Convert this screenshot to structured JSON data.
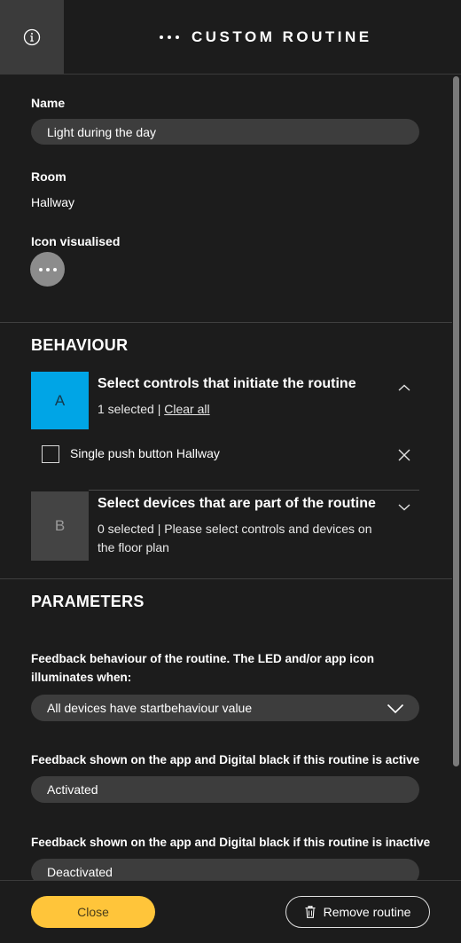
{
  "header": {
    "title": "CUSTOM ROUTINE",
    "info_icon": "info-icon",
    "more_icon": "more-dots-icon"
  },
  "general": {
    "name_label": "Name",
    "name_value": "Light during the day",
    "room_label": "Room",
    "room_value": "Hallway",
    "icon_label": "Icon visualised",
    "icon_name": "more-dots-icon"
  },
  "behaviour": {
    "title": "BEHAVIOUR",
    "controls": {
      "badge": "A",
      "badge_color": "#00a5e6",
      "title": "Select controls that initiate the routine",
      "selected_text": "1 selected |",
      "clear_all": "Clear all",
      "expanded": true,
      "items": [
        {
          "label": "Single push button Hallway",
          "checked": false
        }
      ]
    },
    "devices": {
      "badge": "B",
      "title": "Select devices that are part of the routine",
      "subtitle_line1": "0 selected | Please select controls and devices on",
      "subtitle_line2": "the floor plan",
      "expanded": false
    }
  },
  "parameters": {
    "title": "PARAMETERS",
    "feedback_label_line1": "Feedback behaviour of the routine. The LED and/or app icon",
    "feedback_label_line2": "illuminates when:",
    "feedback_value": "All devices have startbehaviour value",
    "active_label": "Feedback shown on the app and Digital black if this routine is active",
    "active_value": "Activated",
    "inactive_label": "Feedback shown on the app and Digital black if this routine is inactive",
    "inactive_value": "Deactivated"
  },
  "footer": {
    "close_label": "Close",
    "remove_label": "Remove routine",
    "accent_color": "#ffc53a"
  }
}
